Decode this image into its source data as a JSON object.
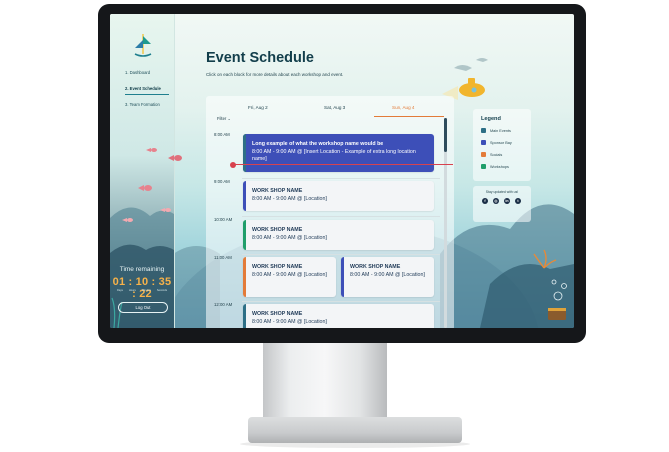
{
  "sidebar": {
    "nav": [
      {
        "label": "1. Dashboard"
      },
      {
        "label": "2. Event Schedule"
      },
      {
        "label": "3. Team Formation"
      }
    ],
    "timer": {
      "label": "Time remaining",
      "value": "01 : 10 : 35 : 22",
      "units": [
        "Days",
        "Hours",
        "Minutes",
        "Seconds"
      ]
    },
    "logout_label": "Log Out"
  },
  "main": {
    "title": "Event Schedule",
    "subtitle": "Click on each block for more details about each workshop and event."
  },
  "schedule": {
    "days": [
      {
        "label": "Fri, Aug 2"
      },
      {
        "label": "Sat, Aug 3"
      },
      {
        "label": "Sun, Aug 4",
        "active": true
      }
    ],
    "filter_label": "Filter  ⌄",
    "times": [
      "8:00 AM",
      "9:00 AM",
      "10:00 AM",
      "11:00 AM",
      "12:00 AM"
    ],
    "events": [
      {
        "name": "Long example of what the workshop name would be",
        "info": "8:00 AM - 9:00 AM  @ [Insert Location - Example of extra long location name]",
        "category": "Main Events"
      },
      {
        "name": "WORK SHOP NAME",
        "info": "8:00 AM - 9:00 AM  @ [Location]",
        "category": "Sponsor Bay"
      },
      {
        "name": "WORK SHOP NAME",
        "info": "8:00 AM - 9:00 AM  @ [Location]",
        "category": "Workshops"
      },
      {
        "name": "WORK SHOP NAME",
        "info": "8:00 AM - 9:00 AM  @ [Location]",
        "category": "Socials"
      },
      {
        "name": "WORK SHOP NAME",
        "info": "8:00 AM - 9:00 AM  @ [Location]",
        "category": "Main Events"
      },
      {
        "name": "WORK SHOP NAME",
        "info": "8:00 AM - 9:00 AM  @ [Location]",
        "category": "Sponsor Bay"
      }
    ]
  },
  "legend": {
    "title": "Legend",
    "items": [
      {
        "label": "Main Events",
        "color": "#2d6f86"
      },
      {
        "label": "Sponsor Bay",
        "color": "#3d4fb8"
      },
      {
        "label": "Socials",
        "color": "#e37b39"
      },
      {
        "label": "Workshops",
        "color": "#1f9e6a"
      }
    ]
  },
  "social": {
    "title": "Stay updated with us!",
    "icons": [
      "facebook-icon",
      "instagram-icon",
      "linkedin-icon",
      "twitter-icon"
    ]
  },
  "colors": {
    "accent": "#e37b39",
    "featured": "#3d4fb8",
    "now_indicator": "#d8424e"
  }
}
